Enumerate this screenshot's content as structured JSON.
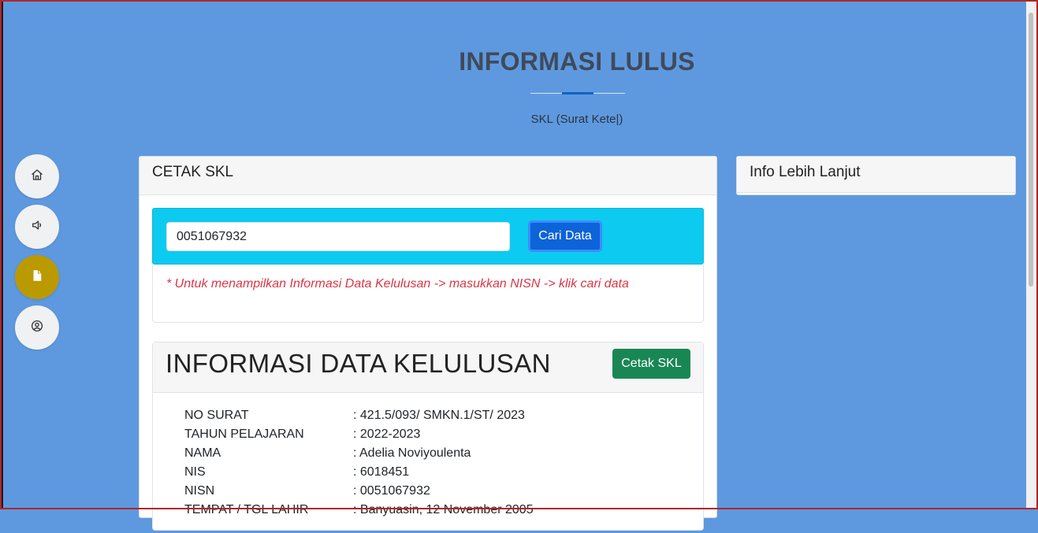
{
  "hero": {
    "title": "INFORMASI LULUS",
    "subtitle": "SKL (Surat Kete|)"
  },
  "sidebar": {
    "items": [
      {
        "icon": "home-icon",
        "active": false
      },
      {
        "icon": "speaker-icon",
        "active": false
      },
      {
        "icon": "document-icon",
        "active": true
      },
      {
        "icon": "user-circle-icon",
        "active": false
      }
    ]
  },
  "cetak": {
    "header": "CETAK SKL",
    "search": {
      "value": "0051067932",
      "button_label": "Cari Data"
    },
    "note": "* Untuk menampilkan Informasi Data Kelulusan -> masukkan NISN -> klik cari data"
  },
  "info": {
    "title": "INFORMASI DATA KELULUSAN",
    "print_button": "Cetak SKL",
    "rows": [
      {
        "label": "NO SURAT",
        "value": ": 421.5/093/ SMKN.1/ST/ 2023"
      },
      {
        "label": "TAHUN PELAJARAN",
        "value": ": 2022-2023"
      },
      {
        "label": "NAMA",
        "value": ": Adelia Noviyoulenta"
      },
      {
        "label": "NIS",
        "value": ": 6018451"
      },
      {
        "label": "NISN",
        "value": ": 0051067932"
      },
      {
        "label": "TEMPAT / TGL LAHIR",
        "value": ": Banyuasin, 12 November 2005"
      }
    ]
  },
  "side_panel": {
    "header": "Info Lebih Lanjut"
  },
  "colors": {
    "background": "#5e99df",
    "active_sidebar": "#bb9a00",
    "search_panel": "#0dcaf0",
    "primary_button": "#0d63d8",
    "success_button": "#198754",
    "note_text": "#dc3545"
  }
}
